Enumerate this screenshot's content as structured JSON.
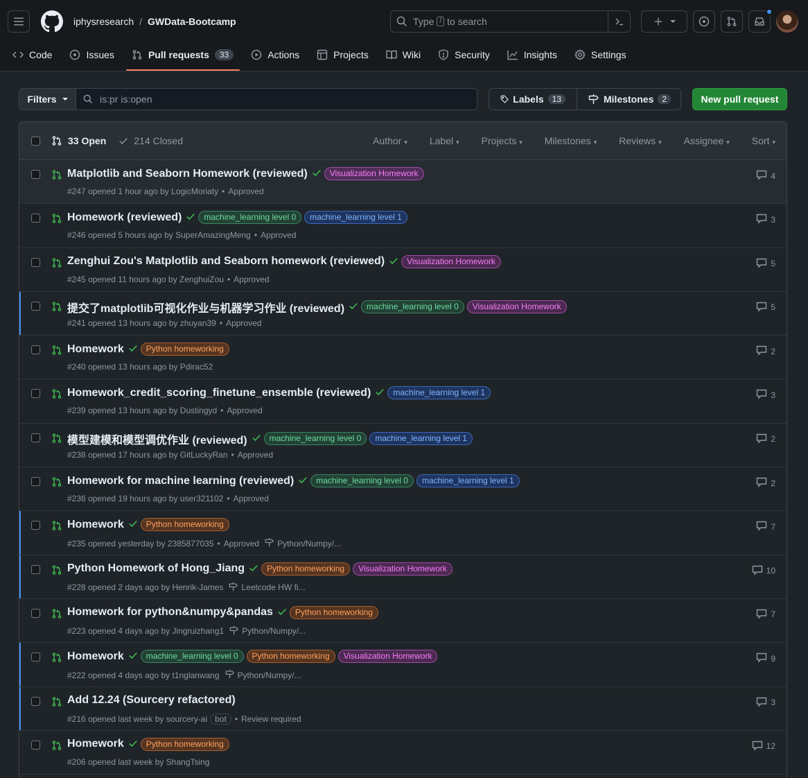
{
  "repo": {
    "owner": "iphysresearch",
    "separator": "/",
    "name": "GWData-Bootcamp"
  },
  "search": {
    "prefix": "Type",
    "key": "/",
    "suffix": "to search"
  },
  "tabs": [
    {
      "label": "Code",
      "icon": "code-icon"
    },
    {
      "label": "Issues",
      "icon": "issue-opened-icon"
    },
    {
      "label": "Pull requests",
      "icon": "git-pull-request-icon",
      "count": "33",
      "active": true
    },
    {
      "label": "Actions",
      "icon": "play-icon"
    },
    {
      "label": "Projects",
      "icon": "table-icon"
    },
    {
      "label": "Wiki",
      "icon": "book-icon"
    },
    {
      "label": "Security",
      "icon": "shield-icon"
    },
    {
      "label": "Insights",
      "icon": "graph-icon"
    },
    {
      "label": "Settings",
      "icon": "gear-icon"
    }
  ],
  "subnav": {
    "filters_label": "Filters",
    "query": "is:pr is:open",
    "labels_label": "Labels",
    "labels_count": "13",
    "milestones_label": "Milestones",
    "milestones_count": "2",
    "new_pr_label": "New pull request"
  },
  "list_header": {
    "open": "33 Open",
    "closed": "214 Closed",
    "filters": [
      "Author",
      "Label",
      "Projects",
      "Milestones",
      "Reviews",
      "Assignee",
      "Sort"
    ]
  },
  "prs": [
    {
      "title": "Matplotlib and Seaborn Homework (reviewed)",
      "labels": [
        [
          "Visualization Homework",
          "viz"
        ]
      ],
      "meta": "#247 opened 1 hour ago by LogicMoriaty",
      "status": "Approved",
      "milestone": "",
      "comments": "4",
      "unread": false,
      "hl": true
    },
    {
      "title": "Homework (reviewed)",
      "labels": [
        [
          "machine_learning level 0",
          "ml0"
        ],
        [
          "machine_learning level 1",
          "ml1"
        ]
      ],
      "meta": "#246 opened 5 hours ago by SuperAmazingMeng",
      "status": "Approved",
      "milestone": "",
      "comments": "3",
      "unread": false
    },
    {
      "title": "Zenghui Zou's Matplotlib and Seaborn homework (reviewed)",
      "labels": [
        [
          "Visualization Homework",
          "viz"
        ]
      ],
      "meta": "#245 opened 11 hours ago by ZenghuiZou",
      "status": "Approved",
      "milestone": "",
      "comments": "5",
      "unread": false
    },
    {
      "title": "提交了matplotlib可视化作业与机器学习作业 (reviewed)",
      "labels": [
        [
          "machine_learning level 0",
          "ml0"
        ],
        [
          "Visualization Homework",
          "viz"
        ]
      ],
      "meta": "#241 opened 13 hours ago by zhuyan39",
      "status": "Approved",
      "milestone": "",
      "comments": "5",
      "unread": true
    },
    {
      "title": "Homework",
      "labels": [
        [
          "Python homeworking",
          "py"
        ]
      ],
      "meta": "#240 opened 13 hours ago by Pdirac52",
      "status": "",
      "milestone": "",
      "comments": "2",
      "unread": false
    },
    {
      "title": "Homework_credit_scoring_finetune_ensemble (reviewed)",
      "labels": [
        [
          "machine_learning level 1",
          "ml1"
        ]
      ],
      "meta": "#239 opened 13 hours ago by Dustingyd",
      "status": "Approved",
      "milestone": "",
      "comments": "3",
      "unread": false
    },
    {
      "title": "模型建模和模型调优作业 (reviewed)",
      "labels": [
        [
          "machine_learning level 0",
          "ml0"
        ],
        [
          "machine_learning level 1",
          "ml1"
        ]
      ],
      "meta": "#238 opened 17 hours ago by GitLuckyRan",
      "status": "Approved",
      "milestone": "",
      "comments": "2",
      "unread": false
    },
    {
      "title": "Homework for machine learning (reviewed)",
      "labels": [
        [
          "machine_learning level 0",
          "ml0"
        ],
        [
          "machine_learning level 1",
          "ml1"
        ]
      ],
      "meta": "#236 opened 19 hours ago by user321102",
      "status": "Approved",
      "milestone": "",
      "comments": "2",
      "unread": false
    },
    {
      "title": "Homework",
      "labels": [
        [
          "Python homeworking",
          "py"
        ]
      ],
      "meta": "#235 opened yesterday by 2385877035",
      "status": "Approved",
      "milestone": "Python/Numpy/...",
      "comments": "7",
      "unread": true
    },
    {
      "title": "Python Homework of Hong_Jiang",
      "labels": [
        [
          "Python homeworking",
          "py"
        ],
        [
          "Visualization Homework",
          "viz"
        ]
      ],
      "meta": "#228 opened 2 days ago by Henrik-James",
      "status": "",
      "milestone": "Leetcode HW fi...",
      "comments": "10",
      "unread": true
    },
    {
      "title": "Homework for python&numpy&pandas",
      "labels": [
        [
          "Python homeworking",
          "py"
        ]
      ],
      "meta": "#223 opened 4 days ago by Jingruizhang1",
      "status": "",
      "milestone": "Python/Numpy/...",
      "comments": "7",
      "unread": false
    },
    {
      "title": "Homework",
      "labels": [
        [
          "machine_learning level 0",
          "ml0"
        ],
        [
          "Python homeworking",
          "py"
        ],
        [
          "Visualization Homework",
          "viz"
        ]
      ],
      "meta": "#222 opened 4 days ago by t1nglanwang",
      "status": "",
      "milestone": "Python/Numpy/...",
      "comments": "9",
      "unread": true
    },
    {
      "title": "Add 12.24 (Sourcery refactored)",
      "labels": [],
      "meta": "#216 opened last week by sourcery-ai",
      "bot": "bot",
      "status": "Review required",
      "milestone": "",
      "comments": "3",
      "unread": true,
      "nocheck": true
    },
    {
      "title": "Homework",
      "labels": [
        [
          "Python homeworking",
          "py"
        ]
      ],
      "meta": "#206 opened last week by ShangTsing",
      "status": "",
      "milestone": "",
      "comments": "12",
      "unread": false
    }
  ]
}
